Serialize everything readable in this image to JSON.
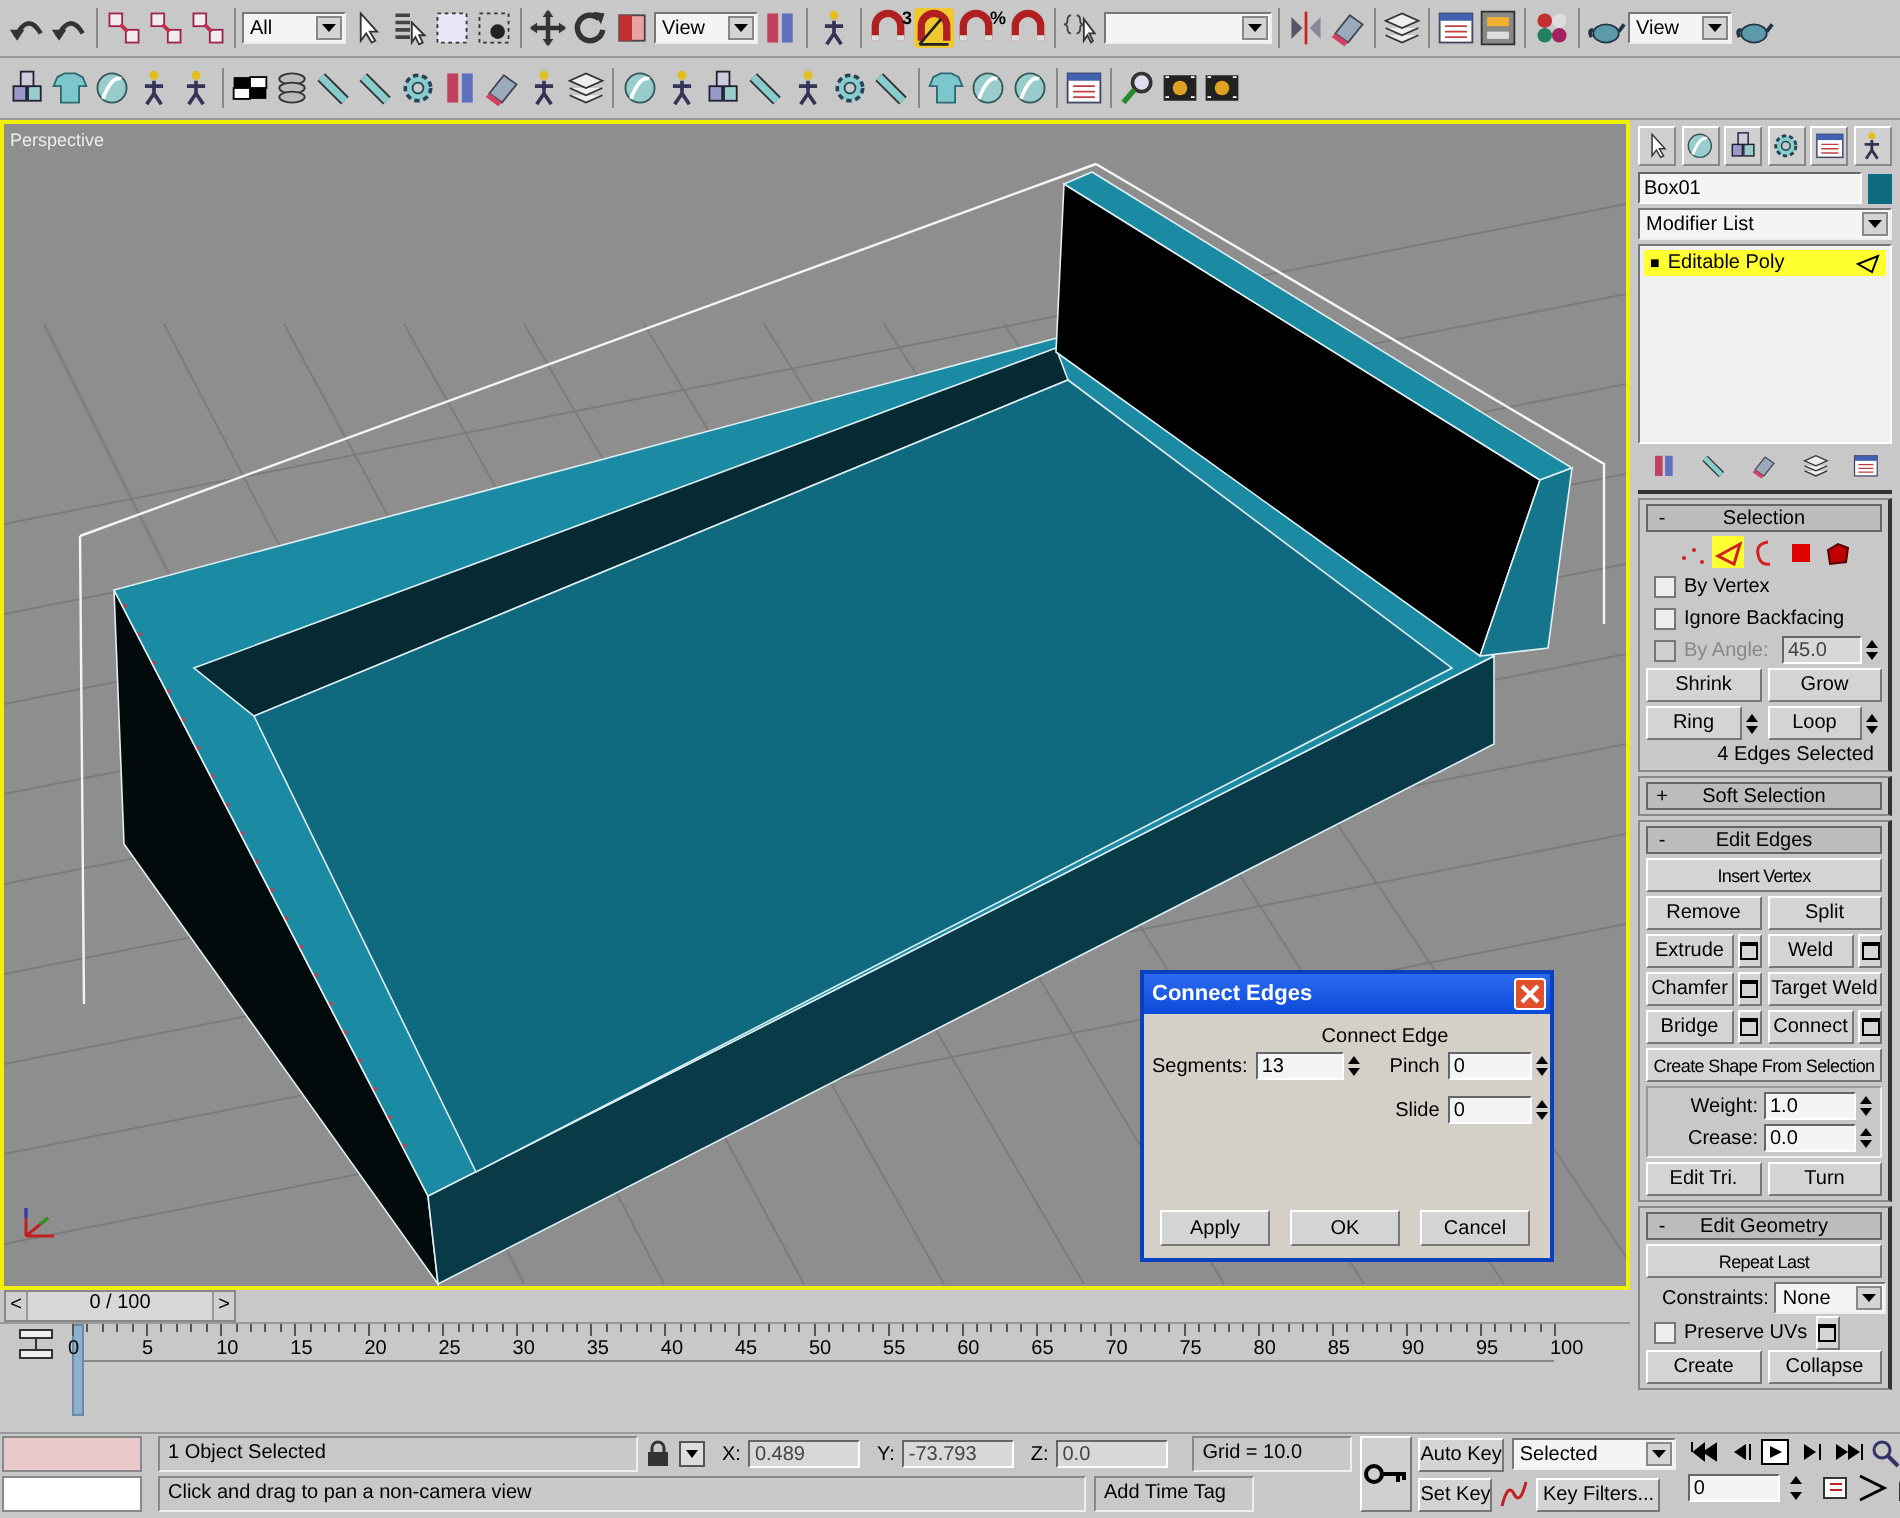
{
  "toolbar": {
    "selection_filter": "All",
    "reference_coordinate_system": "View",
    "snap_label": "3",
    "angle_snap_on": true,
    "percent_snap_label": "%",
    "render_view": "View"
  },
  "viewport": {
    "label": "Perspective",
    "active": true
  },
  "dialog": {
    "title": "Connect Edges",
    "group_label": "Connect Edge",
    "fields": [
      {
        "label": "Segments:",
        "value": "13"
      },
      {
        "label": "Pinch",
        "value": "0"
      },
      {
        "label": "Slide",
        "value": "0"
      }
    ],
    "buttons": [
      "Apply",
      "OK",
      "Cancel"
    ]
  },
  "command_panel": {
    "object_name": "Box01",
    "modifier_list": "Modifier List",
    "stack": [
      {
        "toggle": "■",
        "label": "Editable Poly",
        "selected": true
      }
    ],
    "selection_rollout": {
      "toggle": "-",
      "title": "Selection",
      "levels": [
        {
          "kind": "vertex",
          "selected": false
        },
        {
          "kind": "edge",
          "selected": true
        },
        {
          "kind": "border",
          "selected": false
        },
        {
          "kind": "polygon",
          "selected": false
        },
        {
          "kind": "element",
          "selected": false
        }
      ],
      "checkboxes": [
        {
          "label": "By Vertex",
          "checked": false,
          "disabled": false
        },
        {
          "label": "Ignore Backfacing",
          "checked": false,
          "disabled": false
        },
        {
          "label": "By Angle:",
          "checked": false,
          "disabled": true,
          "value": "45.0"
        }
      ],
      "button_rows": [
        [
          {
            "label": "Shrink",
            "kind": "plain"
          },
          {
            "label": "Grow",
            "kind": "plain"
          }
        ],
        [
          {
            "label": "Ring",
            "kind": "spinner"
          },
          {
            "label": "Loop",
            "kind": "spinner"
          }
        ]
      ],
      "status": "4 Edges Selected"
    },
    "soft_selection_rollout": {
      "toggle": "+",
      "title": "Soft Selection"
    },
    "edit_edges_rollout": {
      "toggle": "-",
      "title": "Edit Edges",
      "button_rows": [
        [
          {
            "label": "Insert Vertex",
            "kind": "plain"
          }
        ],
        [
          {
            "label": "Remove",
            "kind": "plain"
          },
          {
            "label": "Split",
            "kind": "plain"
          }
        ],
        [
          {
            "label": "Extrude",
            "kind": "settings"
          },
          {
            "label": "Weld",
            "kind": "settings"
          }
        ],
        [
          {
            "label": "Chamfer",
            "kind": "settings"
          },
          {
            "label": "Target Weld",
            "kind": "plain"
          }
        ],
        [
          {
            "label": "Bridge",
            "kind": "settings"
          },
          {
            "label": "Connect",
            "kind": "settings"
          }
        ],
        [
          {
            "label": "Create Shape From Selection",
            "kind": "plain"
          }
        ]
      ],
      "spinners": [
        {
          "label": "Weight:",
          "value": "1.0"
        },
        {
          "label": "Crease:",
          "value": "0.0"
        }
      ],
      "bottom_buttons": [
        "Edit Tri.",
        "Turn"
      ]
    },
    "edit_geometry_rollout": {
      "toggle": "-",
      "title": "Edit Geometry",
      "repeat_last": "Repeat Last",
      "constraints_label": "Constraints:",
      "constraints_value": "None",
      "preserve_uvs": {
        "label": "Preserve UVs",
        "checked": false
      },
      "bottom_buttons": [
        "Create",
        "Collapse"
      ]
    }
  },
  "timeline": {
    "prev": "<",
    "position": "0 / 100",
    "next": ">",
    "ruler_labels": [
      "0",
      "5",
      "10",
      "15",
      "20",
      "25",
      "30",
      "35",
      "40",
      "45",
      "50",
      "55",
      "60",
      "65",
      "70",
      "75",
      "80",
      "85",
      "90",
      "95",
      "100"
    ]
  },
  "status_bar": {
    "prompt": "1 Object Selected",
    "hint": "Click and drag to pan a non-camera view",
    "coordinates": [
      {
        "axis": "X:",
        "value": "0.489"
      },
      {
        "axis": "Y:",
        "value": "-73.793"
      },
      {
        "axis": "Z:",
        "value": "0.0"
      }
    ],
    "grid": "Grid = 10.0",
    "time_tag": "Add Time Tag",
    "auto_key": "Auto Key",
    "set_key": "Set Key",
    "key_mode": "Selected",
    "key_filters": "Key Filters...",
    "frame": "0"
  }
}
